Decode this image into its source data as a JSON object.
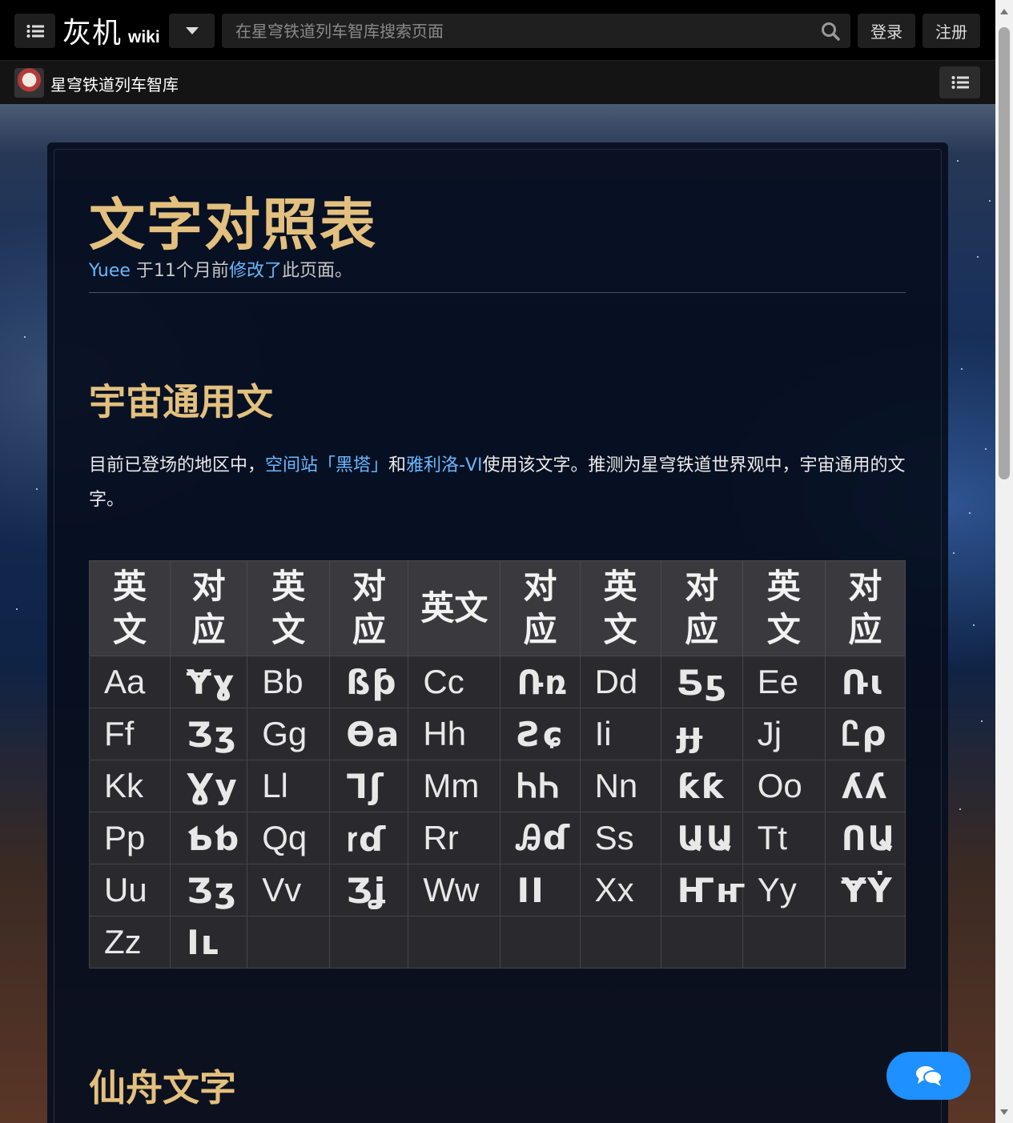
{
  "topbar": {
    "logo_main": "灰机",
    "logo_wiki": "wiki",
    "search_placeholder": "在星穹铁道列车智库搜索页面",
    "login": "登录",
    "register": "注册"
  },
  "site": {
    "title": "星穹铁道列车智库"
  },
  "page": {
    "title": "文字对照表",
    "editor": "Yuee",
    "edit_time": " 于11个月前",
    "edit_link": "修改了",
    "edit_suffix": "此页面。"
  },
  "section1": {
    "heading": "宇宙通用文",
    "para_pre": "目前已登场的地区中，",
    "link1": "空间站「黑塔」",
    "para_mid": "和",
    "link2": "雅利洛-VI",
    "para_post": "使用该文字。推测为星穹铁道世界观中，宇宙通用的文字。"
  },
  "table": {
    "headers": [
      "英文",
      "对应",
      "英文",
      "对应",
      "英文",
      "对应",
      "英文",
      "对应",
      "英文",
      "对应"
    ],
    "rows": [
      [
        "Aa",
        "Ɏɣ",
        "Bb",
        "ßƥ",
        "Cc",
        "Ռռ",
        "Dd",
        "Ƽƽ",
        "Ee",
        "Ռɩ"
      ],
      [
        "Ff",
        "Ʒʒ",
        "Gg",
        "Ѳa",
        "Hh",
        "Ƨɕ",
        "Ii",
        "ɟɟ",
        "Jj",
        "Ꮭρ"
      ],
      [
        "Kk",
        "Ɣy",
        "Ll",
        "Ꞁʃ",
        "Mm",
        "ᏂᏂ",
        "Nn",
        "ƙƙ",
        "Oo",
        "ʎʎ"
      ],
      [
        "Pp",
        "Ƅƅ",
        "Qq",
        "ꭇɗ",
        "Rr",
        "Ꭿɗ",
        "Ss",
        "ԱԱ",
        "Tt",
        "ՈԱ"
      ],
      [
        "Uu",
        "Ʒʒ",
        "Vv",
        "Ʒʝ",
        "Ww",
        "ӀӀ",
        "Xx",
        "Ҥҥ",
        "Yy",
        "ɎẎ"
      ],
      [
        "Zz",
        "Ӏʟ",
        "",
        "",
        "",
        "",
        "",
        "",
        "",
        ""
      ]
    ]
  },
  "section2": {
    "heading": "仙舟文字"
  },
  "icons": {
    "menu": "list-icon",
    "dropdown": "caret-down-icon",
    "search": "search-icon",
    "chat": "comments-icon"
  }
}
